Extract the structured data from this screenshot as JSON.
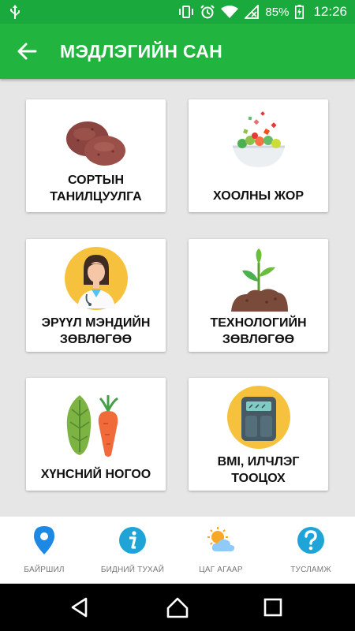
{
  "status_bar": {
    "battery_percent": "85%",
    "time": "12:26"
  },
  "app_bar": {
    "title": "МЭДЛЭГИЙН САН"
  },
  "cards": [
    {
      "label_line1": "СОРТЫН",
      "label_line2": "ТАНИЛЦУУЛГА",
      "icon": "potato-icon"
    },
    {
      "label_line1": "ХООЛНЫ ЖОР",
      "label_line2": "",
      "icon": "salad-bowl-icon"
    },
    {
      "label_line1": "ЭРҮҮЛ МЭНДИЙН",
      "label_line2": "ЗӨВЛӨГӨӨ",
      "icon": "doctor-icon"
    },
    {
      "label_line1": "ТЕХНОЛОГИЙН",
      "label_line2": "ЗӨВЛӨГӨӨ",
      "icon": "sprout-icon"
    },
    {
      "label_line1": "ХҮНСНИЙ НОГОО",
      "label_line2": "",
      "icon": "vegetables-icon"
    },
    {
      "label_line1": "BMI, ИЛЧЛЭГ",
      "label_line2": "ТООЦОХ",
      "icon": "scale-icon"
    }
  ],
  "bottom_nav": [
    {
      "label": "БАЙРШИЛ",
      "icon": "location-pin-icon"
    },
    {
      "label": "БИДНИЙ ТУХАЙ",
      "icon": "info-icon"
    },
    {
      "label": "ЦАГ АГААР",
      "icon": "weather-icon"
    },
    {
      "label": "ТУСЛАМЖ",
      "icon": "help-icon"
    }
  ],
  "colors": {
    "status_bar": "#1aa93c",
    "app_bar": "#21b53f",
    "background": "#e6e6e6",
    "nav_blue": "#1e88e5",
    "icon_blue": "#1fa4d8"
  }
}
